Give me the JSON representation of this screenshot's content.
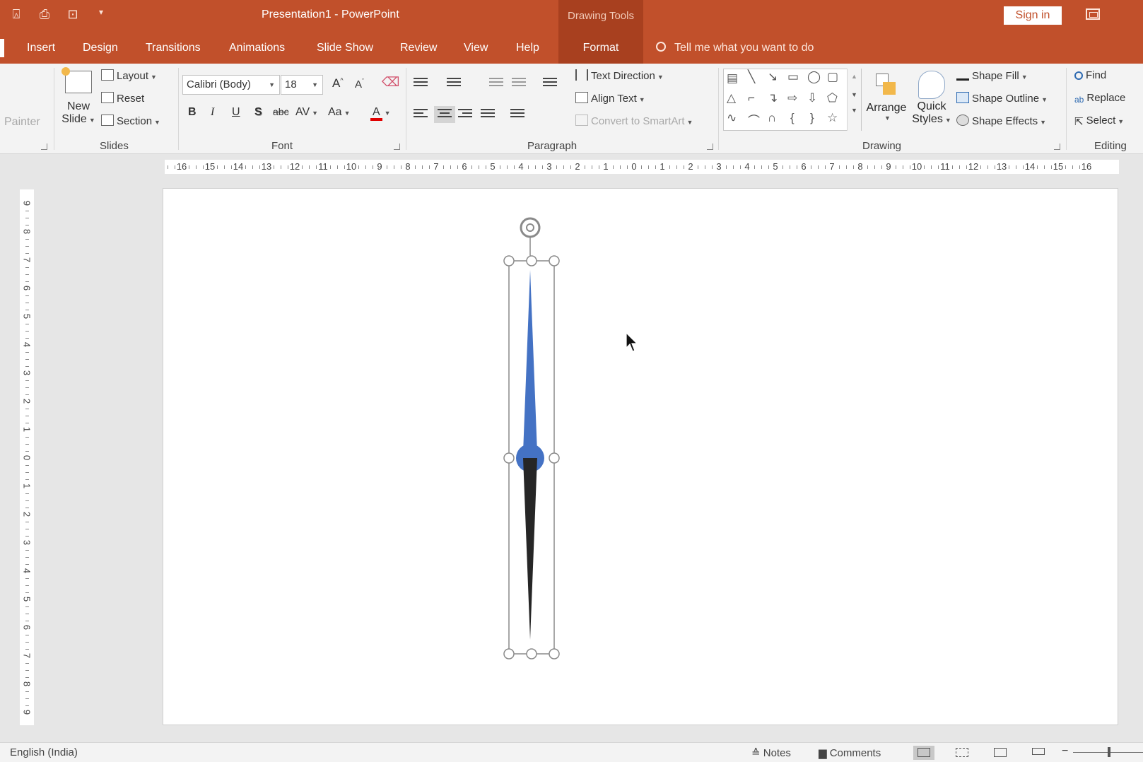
{
  "titlebar": {
    "title": "Presentation1  -  PowerPoint",
    "context_tab": "Drawing Tools",
    "sign_in": "Sign in",
    "qat_icons": [
      "presenter-icon",
      "print-icon",
      "touch-mode-icon",
      "customize-qat-icon"
    ]
  },
  "tabs": [
    "Insert",
    "Design",
    "Transitions",
    "Animations",
    "Slide Show",
    "Review",
    "View",
    "Help"
  ],
  "active_tab": "Format",
  "tell_me": "Tell me what you want to do",
  "ribbon": {
    "clipboard": {
      "painter": "Painter"
    },
    "slides": {
      "new_slide_line1": "New",
      "new_slide_line2": "Slide",
      "layout": "Layout",
      "reset": "Reset",
      "section": "Section",
      "group": "Slides"
    },
    "font": {
      "name": "Calibri (Body)",
      "size": "18",
      "bold": "B",
      "italic": "I",
      "underline": "U",
      "shadow": "S",
      "strike": "abc",
      "spacing": "AV",
      "case": "Aa",
      "color": "A",
      "grow": "A",
      "shrink": "A",
      "group": "Font"
    },
    "paragraph": {
      "text_direction": "Text Direction",
      "align_text": "Align Text",
      "convert_smartart": "Convert to SmartArt",
      "group": "Paragraph"
    },
    "drawing": {
      "arrange": "Arrange",
      "quick_line1": "Quick",
      "quick_line2": "Styles",
      "shape_fill": "Shape Fill",
      "shape_outline": "Shape Outline",
      "shape_effects": "Shape Effects",
      "group": "Drawing"
    },
    "editing": {
      "find": "Find",
      "replace": "Replace",
      "select": "Select",
      "group": "Editing"
    }
  },
  "ruler": {
    "horizontal": [
      "16",
      "15",
      "14",
      "13",
      "12",
      "11",
      "10",
      "9",
      "8",
      "7",
      "6",
      "5",
      "4",
      "3",
      "2",
      "1",
      "0",
      "1",
      "2",
      "3",
      "4",
      "5",
      "6",
      "7",
      "8",
      "9",
      "10",
      "11",
      "12",
      "13",
      "14",
      "15",
      "16"
    ],
    "vertical": [
      "9",
      "8",
      "7",
      "6",
      "5",
      "4",
      "3",
      "2",
      "1",
      "0",
      "1",
      "2",
      "3",
      "4",
      "5",
      "6",
      "7",
      "8",
      "9"
    ]
  },
  "shape": {
    "top_color": "#4472c4",
    "bottom_color": "#262626",
    "selection_color": "#808080"
  },
  "status": {
    "language": "English (India)",
    "notes": "Notes",
    "comments": "Comments"
  },
  "colors": {
    "accent": "#c1502b",
    "context_tab": "#a8401f",
    "font_color_bar": "#e00000"
  }
}
